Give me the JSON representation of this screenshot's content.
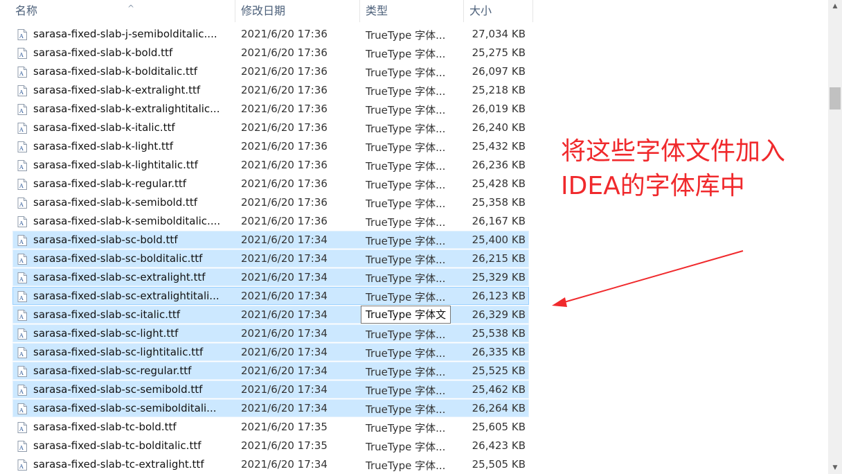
{
  "header": {
    "name": "名称",
    "date": "修改日期",
    "type": "类型",
    "size": "大小",
    "sort_arrow": "^"
  },
  "rows": [
    {
      "name": "sarasa-fixed-slab-j-semibolditalic....",
      "date": "2021/6/20 17:36",
      "type": "TrueType 字体...",
      "size": "27,034 KB",
      "selected": false
    },
    {
      "name": "sarasa-fixed-slab-k-bold.ttf",
      "date": "2021/6/20 17:36",
      "type": "TrueType 字体...",
      "size": "25,275 KB",
      "selected": false
    },
    {
      "name": "sarasa-fixed-slab-k-bolditalic.ttf",
      "date": "2021/6/20 17:36",
      "type": "TrueType 字体...",
      "size": "26,097 KB",
      "selected": false
    },
    {
      "name": "sarasa-fixed-slab-k-extralight.ttf",
      "date": "2021/6/20 17:36",
      "type": "TrueType 字体...",
      "size": "25,218 KB",
      "selected": false
    },
    {
      "name": "sarasa-fixed-slab-k-extralightitalic...",
      "date": "2021/6/20 17:36",
      "type": "TrueType 字体...",
      "size": "26,019 KB",
      "selected": false
    },
    {
      "name": "sarasa-fixed-slab-k-italic.ttf",
      "date": "2021/6/20 17:36",
      "type": "TrueType 字体...",
      "size": "26,240 KB",
      "selected": false
    },
    {
      "name": "sarasa-fixed-slab-k-light.ttf",
      "date": "2021/6/20 17:36",
      "type": "TrueType 字体...",
      "size": "25,432 KB",
      "selected": false
    },
    {
      "name": "sarasa-fixed-slab-k-lightitalic.ttf",
      "date": "2021/6/20 17:36",
      "type": "TrueType 字体...",
      "size": "26,236 KB",
      "selected": false
    },
    {
      "name": "sarasa-fixed-slab-k-regular.ttf",
      "date": "2021/6/20 17:36",
      "type": "TrueType 字体...",
      "size": "25,428 KB",
      "selected": false
    },
    {
      "name": "sarasa-fixed-slab-k-semibold.ttf",
      "date": "2021/6/20 17:36",
      "type": "TrueType 字体...",
      "size": "25,358 KB",
      "selected": false
    },
    {
      "name": "sarasa-fixed-slab-k-semibolditalic....",
      "date": "2021/6/20 17:36",
      "type": "TrueType 字体...",
      "size": "26,167 KB",
      "selected": false
    },
    {
      "name": "sarasa-fixed-slab-sc-bold.ttf",
      "date": "2021/6/20 17:34",
      "type": "TrueType 字体...",
      "size": "25,400 KB",
      "selected": true
    },
    {
      "name": "sarasa-fixed-slab-sc-bolditalic.ttf",
      "date": "2021/6/20 17:34",
      "type": "TrueType 字体...",
      "size": "26,215 KB",
      "selected": true
    },
    {
      "name": "sarasa-fixed-slab-sc-extralight.ttf",
      "date": "2021/6/20 17:34",
      "type": "TrueType 字体...",
      "size": "25,329 KB",
      "selected": true
    },
    {
      "name": "sarasa-fixed-slab-sc-extralightitali...",
      "date": "2021/6/20 17:34",
      "type": "TrueType 字体...",
      "size": "26,123 KB",
      "selected": true,
      "focused": true
    },
    {
      "name": "sarasa-fixed-slab-sc-italic.ttf",
      "date": "2021/6/20 17:34",
      "type": "",
      "size": "26,329 KB",
      "selected": true
    },
    {
      "name": "sarasa-fixed-slab-sc-light.ttf",
      "date": "2021/6/20 17:34",
      "type": "TrueType 字体...",
      "size": "25,538 KB",
      "selected": true
    },
    {
      "name": "sarasa-fixed-slab-sc-lightitalic.ttf",
      "date": "2021/6/20 17:34",
      "type": "TrueType 字体...",
      "size": "26,335 KB",
      "selected": true
    },
    {
      "name": "sarasa-fixed-slab-sc-regular.ttf",
      "date": "2021/6/20 17:34",
      "type": "TrueType 字体...",
      "size": "25,525 KB",
      "selected": true
    },
    {
      "name": "sarasa-fixed-slab-sc-semibold.ttf",
      "date": "2021/6/20 17:34",
      "type": "TrueType 字体...",
      "size": "25,462 KB",
      "selected": true
    },
    {
      "name": "sarasa-fixed-slab-sc-semibolditali...",
      "date": "2021/6/20 17:34",
      "type": "TrueType 字体...",
      "size": "26,264 KB",
      "selected": true
    },
    {
      "name": "sarasa-fixed-slab-tc-bold.ttf",
      "date": "2021/6/20 17:35",
      "type": "TrueType 字体...",
      "size": "25,605 KB",
      "selected": false
    },
    {
      "name": "sarasa-fixed-slab-tc-bolditalic.ttf",
      "date": "2021/6/20 17:35",
      "type": "TrueType 字体...",
      "size": "26,423 KB",
      "selected": false
    },
    {
      "name": "sarasa-fixed-slab-tc-extralight.ttf",
      "date": "2021/6/20 17:34",
      "type": "TrueType 字体...",
      "size": "25,505 KB",
      "selected": false
    }
  ],
  "tooltip": {
    "text": "TrueType 字体文"
  },
  "annotation": {
    "line1": "将这些字体文件加入",
    "line2": "IDEA的字体库中"
  },
  "colors": {
    "annotation": "#f0292c",
    "selected_bg": "#cce8ff",
    "header_text": "#4c607a"
  },
  "icons": {
    "file": "font-file-icon",
    "scroll_up": "chevron-up-icon",
    "scroll_down": "chevron-down-icon"
  }
}
